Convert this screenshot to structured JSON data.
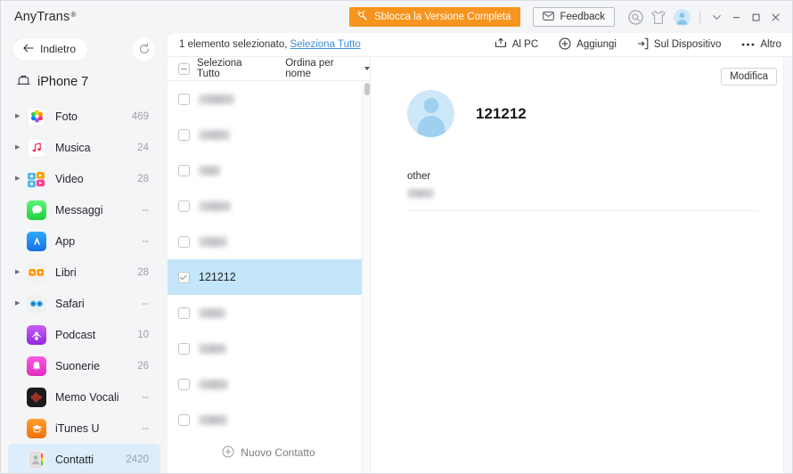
{
  "app": {
    "brand": "AnyTrans",
    "registered_mark": "®"
  },
  "titlebar": {
    "unlock_label": "Sblocca la Versione Completa",
    "unlock_color": "#f7941e",
    "feedback_label": "Feedback",
    "icons": [
      "search-circle-icon",
      "tshirt-theme-icon",
      "account-avatar-icon"
    ],
    "window_controls": [
      "chevron-down-icon",
      "minimize-icon",
      "maximize-icon",
      "close-icon"
    ]
  },
  "sidebar": {
    "back_label": "Indietro",
    "refresh_icon": "refresh-icon",
    "device_name": "iPhone 7",
    "device_icon": "device-icon",
    "items": [
      {
        "label": "Foto",
        "count": "469",
        "expandable": true,
        "icon": "photos-icon",
        "active": false
      },
      {
        "label": "Musica",
        "count": "24",
        "expandable": true,
        "icon": "music-icon",
        "active": false
      },
      {
        "label": "Video",
        "count": "28",
        "expandable": true,
        "icon": "videos-icon",
        "active": false
      },
      {
        "label": "Messaggi",
        "count": "--",
        "expandable": false,
        "icon": "messages-icon",
        "active": false
      },
      {
        "label": "App",
        "count": "--",
        "expandable": false,
        "icon": "appstore-icon",
        "active": false
      },
      {
        "label": "Libri",
        "count": "28",
        "expandable": true,
        "icon": "books-icon",
        "active": false
      },
      {
        "label": "Safari",
        "count": "--",
        "expandable": true,
        "icon": "safari-icon",
        "active": false
      },
      {
        "label": "Podcast",
        "count": "10",
        "expandable": false,
        "icon": "podcast-icon",
        "active": false
      },
      {
        "label": "Suonerie",
        "count": "26",
        "expandable": false,
        "icon": "ringtones-icon",
        "active": false
      },
      {
        "label": "Memo Vocali",
        "count": "--",
        "expandable": false,
        "icon": "voicememo-icon",
        "active": false
      },
      {
        "label": "iTunes U",
        "count": "--",
        "expandable": false,
        "icon": "itunesu-icon",
        "active": false
      },
      {
        "label": "Contatti",
        "count": "2420",
        "expandable": false,
        "icon": "contacts-icon",
        "active": true
      }
    ]
  },
  "content": {
    "selection_text": "1 elemento selezionato,",
    "select_all_link": "Seleziona Tutto",
    "actions": [
      {
        "label": "Al PC",
        "icon": "export-to-pc-icon"
      },
      {
        "label": "Aggiungi",
        "icon": "plus-circle-icon"
      },
      {
        "label": "Sul Dispositivo",
        "icon": "to-device-icon"
      },
      {
        "label": "Altro",
        "icon": "more-dots-icon"
      }
    ]
  },
  "list": {
    "select_all_label": "Seleziona Tutto",
    "sort_label": "Ordina per nome",
    "new_contact_label": "Nuovo Contatto",
    "rows": [
      {
        "name": "",
        "redacted": true,
        "width": 40,
        "selected": false
      },
      {
        "name": "",
        "redacted": true,
        "width": 35,
        "selected": false
      },
      {
        "name": "",
        "redacted": true,
        "width": 24,
        "selected": false
      },
      {
        "name": "",
        "redacted": true,
        "width": 36,
        "selected": false
      },
      {
        "name": "",
        "redacted": true,
        "width": 32,
        "selected": false
      },
      {
        "name": "121212",
        "redacted": false,
        "width": 0,
        "selected": true
      },
      {
        "name": "",
        "redacted": true,
        "width": 30,
        "selected": false
      },
      {
        "name": "",
        "redacted": true,
        "width": 31,
        "selected": false
      },
      {
        "name": "",
        "redacted": true,
        "width": 33,
        "selected": false
      },
      {
        "name": "",
        "redacted": true,
        "width": 32,
        "selected": false
      }
    ]
  },
  "detail": {
    "edit_label": "Modifica",
    "contact_name": "121212",
    "fields": [
      {
        "label": "other",
        "value_redacted": true
      }
    ]
  }
}
